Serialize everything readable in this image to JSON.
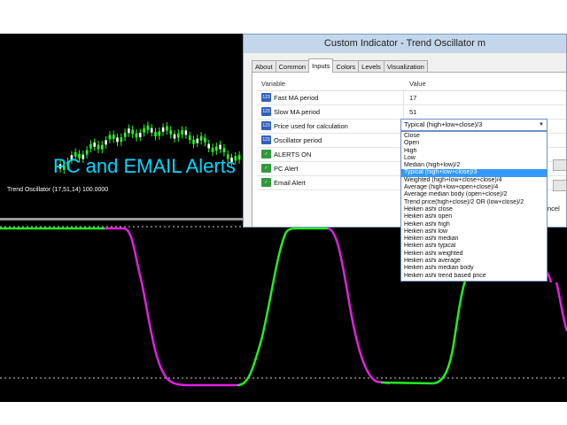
{
  "promo_text": "PC and EMAIL Alerts",
  "oscillator_label": "Trend Oscillator (17,51,14) 100.0000",
  "dialog": {
    "title": "Custom Indicator - Trend Oscillator m",
    "tabs": [
      "About",
      "Common",
      "Inputs",
      "Colors",
      "Levels",
      "Visualization"
    ],
    "active_tab": "Inputs",
    "columns": {
      "variable": "Variable",
      "value": "Value"
    },
    "rows": [
      {
        "name": "Fast MA period",
        "value": "17",
        "icon": "123"
      },
      {
        "name": "Slow MA period",
        "value": "51",
        "icon": "123"
      },
      {
        "name": "Price used for calculation",
        "value": "",
        "icon": "123"
      },
      {
        "name": "Oscillator period",
        "value": "",
        "icon": "123"
      },
      {
        "name": "ALERTS ON",
        "value": "",
        "icon": "check"
      },
      {
        "name": "PC Alert",
        "value": "",
        "icon": "check"
      },
      {
        "name": "Email Alert",
        "value": "",
        "icon": "check"
      }
    ],
    "price_select": {
      "selected": "Typical (high+low+close)/3",
      "options": [
        "Close",
        "Open",
        "High",
        "Low",
        "Median (high+low)/2",
        "Typical (high+low+close)/3",
        "Weighted (high+low+close+close)/4",
        "Average (high+low+open+close)/4",
        "Average median body (open+close)/2",
        "Trend price(high+close)/2 OR (low+close)/2",
        "Heiken ashi close",
        "Heiken ashi open",
        "Heiken ashi high",
        "Heiken ashi low",
        "Heiken ashi median",
        "Heiken ashi typical",
        "Heiken ashi weighted",
        "Heiken ashi average",
        "Heiken ashi median body",
        "Heiken ashi trend based price"
      ]
    },
    "cancel_fragment": "ncel"
  },
  "colors": {
    "chart_bg": "#000000",
    "candle_up": "#22ff22",
    "osc_up": "#22ee22",
    "osc_down": "#e020e0",
    "promo": "#00d8ff",
    "selection": "#3399ff"
  }
}
